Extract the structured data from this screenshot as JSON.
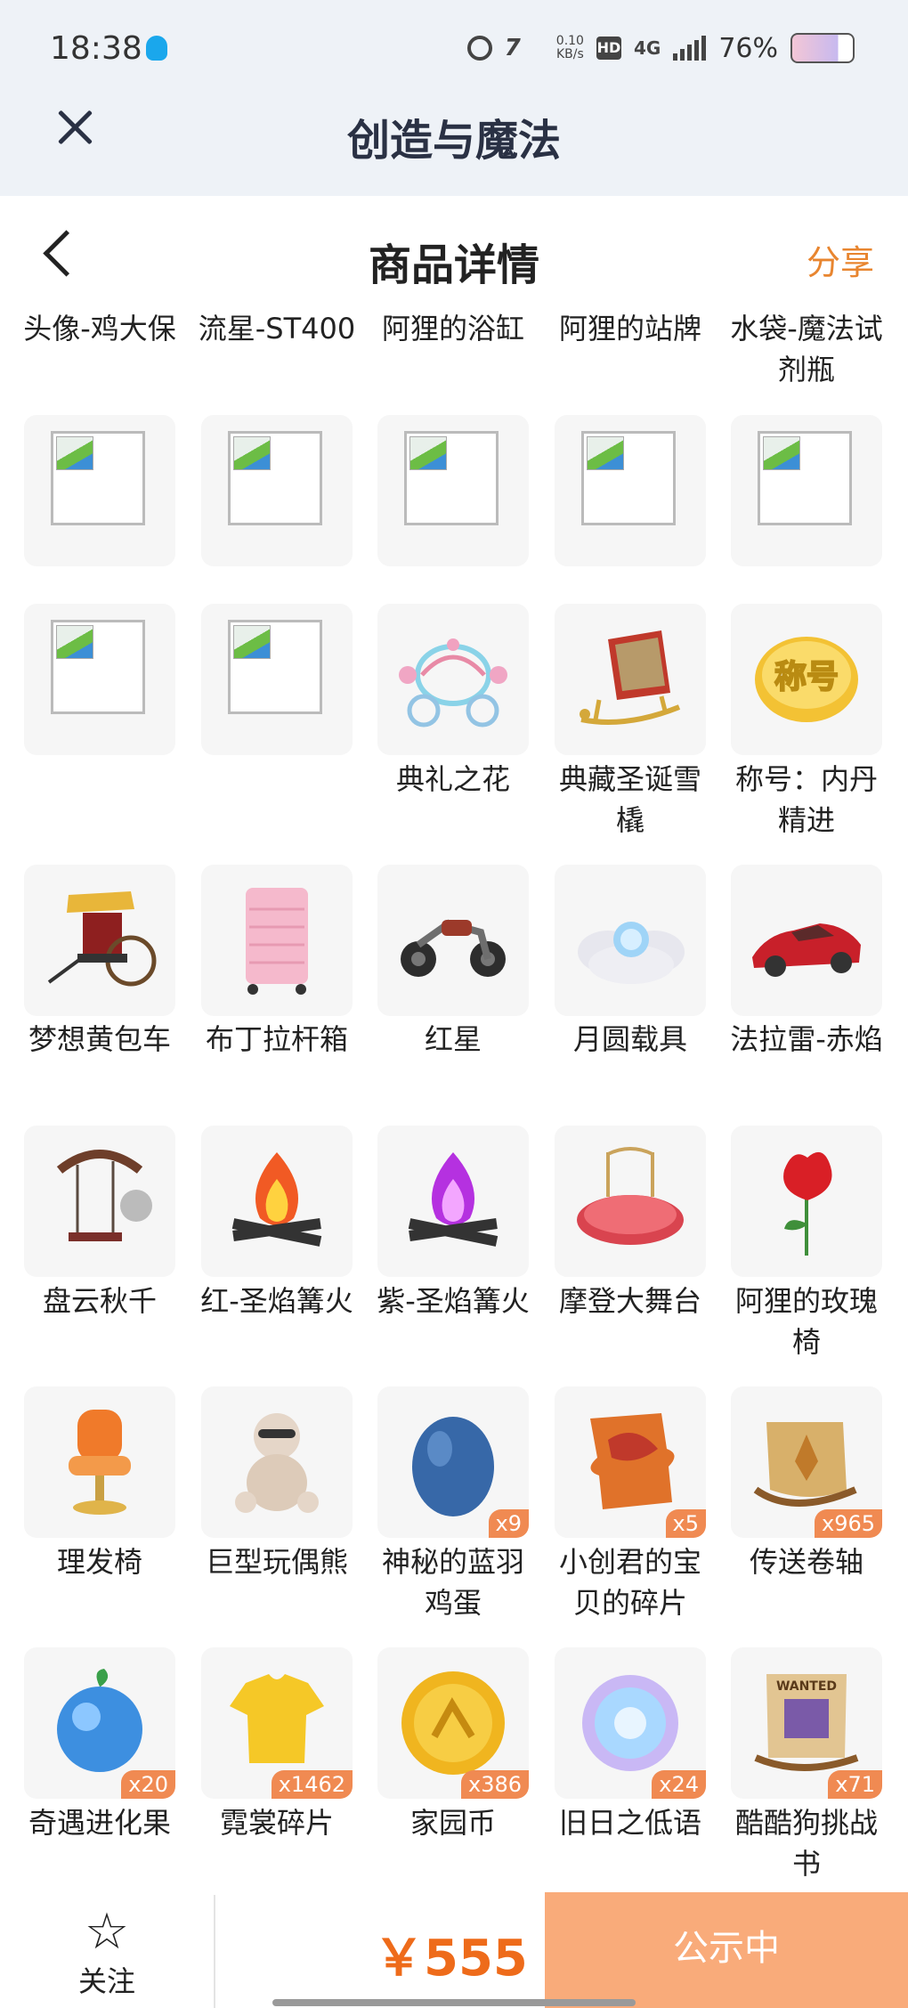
{
  "status_bar": {
    "time": "18:38",
    "speed_value": "0.10",
    "speed_unit": "KB/s",
    "hd": "HD",
    "network": "4G",
    "battery": "76%"
  },
  "header": {
    "title": "创造与魔法"
  },
  "page": {
    "title": "商品详情",
    "share": "分享"
  },
  "top_labels": [
    "头像-鸡大保",
    "流星-ST400",
    "阿狸的浴缸",
    "阿狸的站牌",
    "水袋-魔法试剂瓶"
  ],
  "rows": [
    [
      {
        "name": "",
        "icon": "broken-image"
      },
      {
        "name": "",
        "icon": "broken-image"
      },
      {
        "name": "",
        "icon": "broken-image"
      },
      {
        "name": "",
        "icon": "broken-image"
      },
      {
        "name": "",
        "icon": "broken-image"
      }
    ],
    [
      {
        "name": "",
        "icon": "broken-image"
      },
      {
        "name": "",
        "icon": "broken-image"
      },
      {
        "name": "典礼之花",
        "icon": "carriage"
      },
      {
        "name": "典藏圣诞雪橇",
        "icon": "sleigh"
      },
      {
        "name": "称号：内丹精进",
        "icon": "title-badge",
        "icon_text": "称号"
      }
    ],
    [
      {
        "name": "梦想黄包车",
        "icon": "rickshaw"
      },
      {
        "name": "布丁拉杆箱",
        "icon": "suitcase"
      },
      {
        "name": "红星",
        "icon": "motorcycle"
      },
      {
        "name": "月圆载具",
        "icon": "moon-cloud"
      },
      {
        "name": "法拉雷-赤焰",
        "icon": "sports-car"
      }
    ],
    [
      {
        "name": "盘云秋千",
        "icon": "swing"
      },
      {
        "name": "红-圣焰篝火",
        "icon": "red-bonfire"
      },
      {
        "name": "紫-圣焰篝火",
        "icon": "purple-bonfire"
      },
      {
        "name": "摩登大舞台",
        "icon": "stage"
      },
      {
        "name": "阿狸的玫瑰椅",
        "icon": "rose-chair"
      }
    ],
    [
      {
        "name": "理发椅",
        "icon": "barber-chair"
      },
      {
        "name": "巨型玩偶熊",
        "icon": "teddy-bear"
      },
      {
        "name": "神秘的蓝羽鸡蛋",
        "icon": "blue-egg",
        "badge": "x9"
      },
      {
        "name": "小创君的宝贝的碎片",
        "icon": "puzzle-piece",
        "badge": "x5"
      },
      {
        "name": "传送卷轴",
        "icon": "scroll",
        "badge": "x965"
      }
    ],
    [
      {
        "name": "奇遇进化果",
        "icon": "blue-fruit",
        "badge": "x20"
      },
      {
        "name": "霓裳碎片",
        "icon": "yellow-shirt",
        "badge": "x1462"
      },
      {
        "name": "家园币",
        "icon": "gold-coin",
        "badge": "x386"
      },
      {
        "name": "旧日之低语",
        "icon": "purple-orb",
        "badge": "x24"
      },
      {
        "name": "酷酷狗挑战书",
        "icon": "wanted-poster",
        "badge": "x71",
        "icon_text": "WANTED"
      }
    ]
  ],
  "bottom": {
    "follow_label": "关注",
    "price": "￥555",
    "status_button": "公示中"
  },
  "colors": {
    "accent": "#e8852f",
    "price": "#ee6b1a",
    "status_button": "#f9ab7a",
    "badge": "#f08a52"
  }
}
